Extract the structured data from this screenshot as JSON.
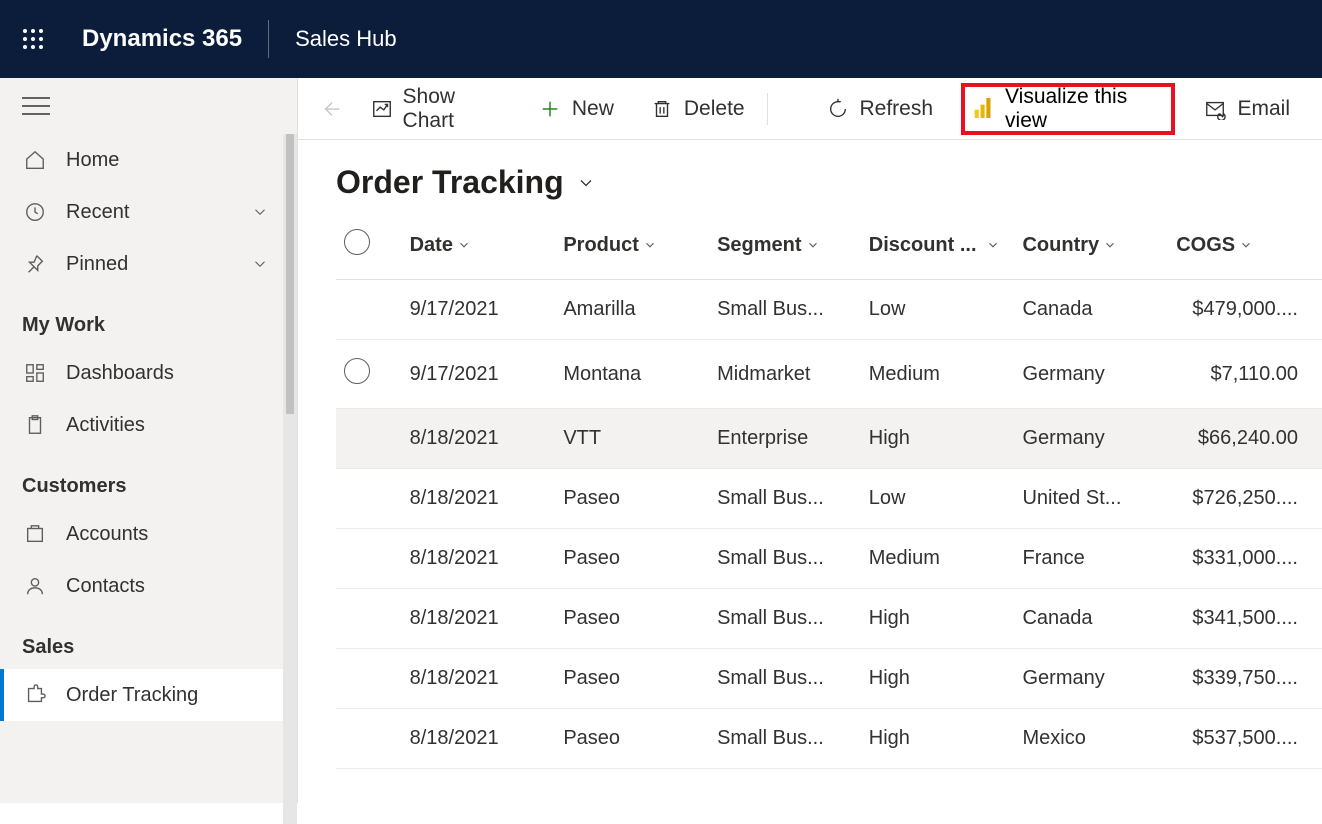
{
  "topbar": {
    "product": "Dynamics 365",
    "hub": "Sales Hub"
  },
  "sidebar": {
    "nav": [
      {
        "key": "home",
        "label": "Home",
        "icon": "home-icon"
      },
      {
        "key": "recent",
        "label": "Recent",
        "icon": "clock-icon",
        "expandable": true
      },
      {
        "key": "pinned",
        "label": "Pinned",
        "icon": "pin-icon",
        "expandable": true
      }
    ],
    "sections": [
      {
        "title": "My Work",
        "items": [
          {
            "key": "dashboards",
            "label": "Dashboards",
            "icon": "dashboard-icon"
          },
          {
            "key": "activities",
            "label": "Activities",
            "icon": "clipboard-icon"
          }
        ]
      },
      {
        "title": "Customers",
        "items": [
          {
            "key": "accounts",
            "label": "Accounts",
            "icon": "account-icon"
          },
          {
            "key": "contacts",
            "label": "Contacts",
            "icon": "person-icon"
          }
        ]
      },
      {
        "title": "Sales",
        "items": [
          {
            "key": "order-tracking",
            "label": "Order Tracking",
            "icon": "puzzle-icon",
            "active": true
          }
        ]
      }
    ]
  },
  "commands": {
    "showChart": "Show Chart",
    "new": "New",
    "delete": "Delete",
    "refresh": "Refresh",
    "visualize": "Visualize this view",
    "email": "Email"
  },
  "view": {
    "title": "Order Tracking"
  },
  "columns": {
    "date": "Date",
    "product": "Product",
    "segment": "Segment",
    "discount": "Discount ...",
    "country": "Country",
    "cogs": "COGS"
  },
  "rows": [
    {
      "date": "9/17/2021",
      "product": "Amarilla",
      "segment": "Small Bus...",
      "discount": "Low",
      "country": "Canada",
      "cogs": "$479,000...."
    },
    {
      "date": "9/17/2021",
      "product": "Montana",
      "segment": "Midmarket",
      "discount": "Medium",
      "country": "Germany",
      "cogs": "$7,110.00",
      "showCheck": true
    },
    {
      "date": "8/18/2021",
      "product": "VTT",
      "segment": "Enterprise",
      "discount": "High",
      "country": "Germany",
      "cogs": "$66,240.00",
      "highlight": true
    },
    {
      "date": "8/18/2021",
      "product": "Paseo",
      "segment": "Small Bus...",
      "discount": "Low",
      "country": "United St...",
      "cogs": "$726,250...."
    },
    {
      "date": "8/18/2021",
      "product": "Paseo",
      "segment": "Small Bus...",
      "discount": "Medium",
      "country": "France",
      "cogs": "$331,000...."
    },
    {
      "date": "8/18/2021",
      "product": "Paseo",
      "segment": "Small Bus...",
      "discount": "High",
      "country": "Canada",
      "cogs": "$341,500...."
    },
    {
      "date": "8/18/2021",
      "product": "Paseo",
      "segment": "Small Bus...",
      "discount": "High",
      "country": "Germany",
      "cogs": "$339,750...."
    },
    {
      "date": "8/18/2021",
      "product": "Paseo",
      "segment": "Small Bus...",
      "discount": "High",
      "country": "Mexico",
      "cogs": "$537,500...."
    }
  ]
}
